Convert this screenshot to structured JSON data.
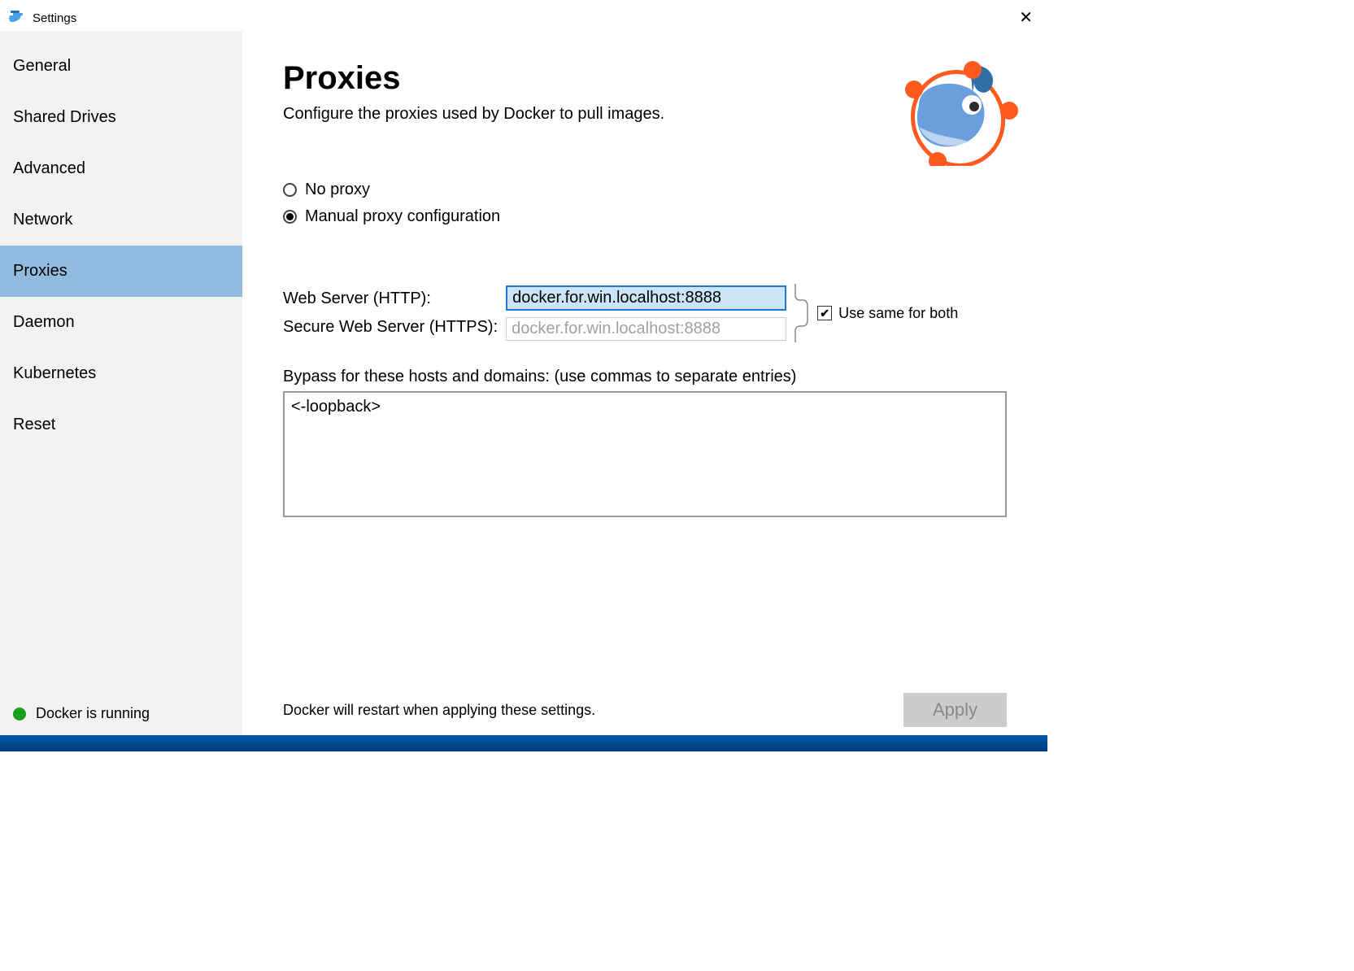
{
  "window": {
    "title": "Settings"
  },
  "sidebar": {
    "items": [
      {
        "label": "General"
      },
      {
        "label": "Shared Drives"
      },
      {
        "label": "Advanced"
      },
      {
        "label": "Network"
      },
      {
        "label": "Proxies"
      },
      {
        "label": "Daemon"
      },
      {
        "label": "Kubernetes"
      },
      {
        "label": "Reset"
      }
    ],
    "selected_index": 4,
    "status_text": "Docker is running"
  },
  "main": {
    "title": "Proxies",
    "subtitle": "Configure the proxies used by Docker to pull images.",
    "radios": {
      "no_proxy": "No proxy",
      "manual": "Manual proxy configuration",
      "selected": "manual"
    },
    "http_label": "Web Server (HTTP):",
    "http_value": "docker.for.win.localhost:8888",
    "https_label": "Secure Web Server (HTTPS):",
    "https_value": "docker.for.win.localhost:8888",
    "use_same_label": "Use same for both",
    "use_same_checked": true,
    "bypass_label": "Bypass for these hosts and domains: (use commas to separate entries)",
    "bypass_value": "<-loopback>",
    "restart_notice": "Docker will restart when applying these settings.",
    "apply_label": "Apply"
  }
}
